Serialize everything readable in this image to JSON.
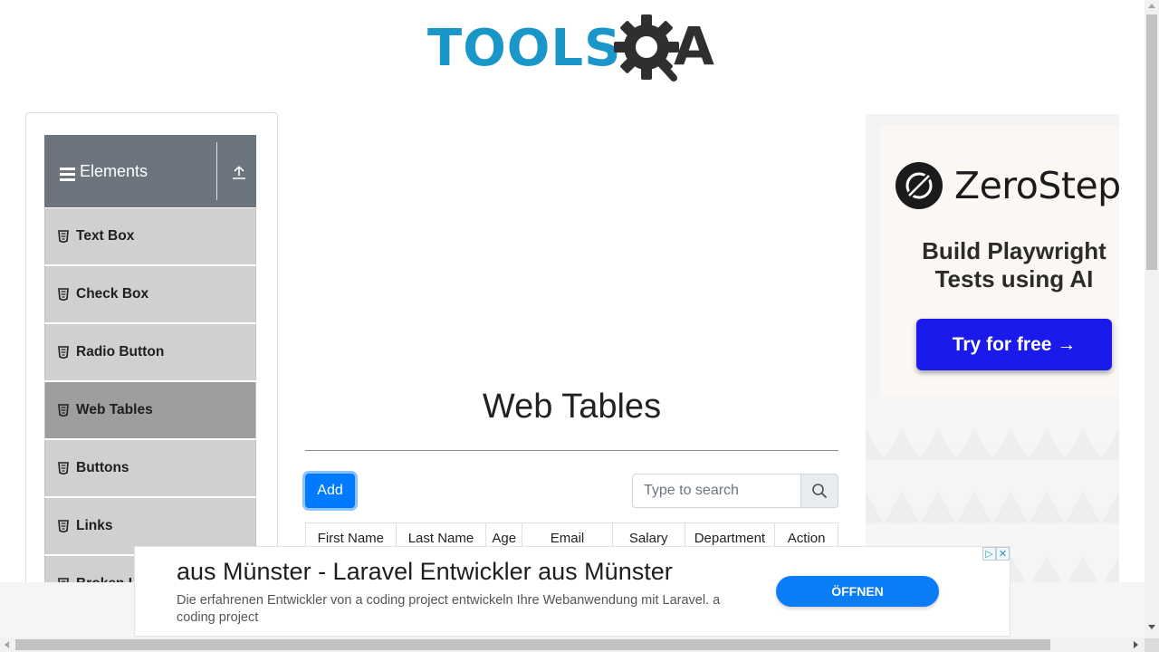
{
  "header": {
    "logo_text": "TOOLS",
    "logo_suffix": "A"
  },
  "sidebar": {
    "group_title": "Elements",
    "items": [
      {
        "label": "Text Box",
        "active": false
      },
      {
        "label": "Check Box",
        "active": false
      },
      {
        "label": "Radio Button",
        "active": false
      },
      {
        "label": "Web Tables",
        "active": true
      },
      {
        "label": "Buttons",
        "active": false
      },
      {
        "label": "Links",
        "active": false
      },
      {
        "label": "Broken Links - Images",
        "active": false
      }
    ]
  },
  "main": {
    "title": "Web Tables",
    "add_label": "Add",
    "search_placeholder": "Type to search",
    "columns": [
      "First Name",
      "Last Name",
      "Age",
      "Email",
      "Salary",
      "Department",
      "Action"
    ]
  },
  "side_ad": {
    "brand": "ZeroStep",
    "tagline": "Build Playwright Tests using AI",
    "cta": "Try for free →"
  },
  "bottom_ad": {
    "headline": "aus Münster - Laravel Entwickler aus Münster",
    "description": "Die erfahrenen Entwickler von a coding project entwickeln Ihre Webanwendung mit Laravel. a coding project",
    "button": "ÖFFNEN"
  },
  "colors": {
    "logo_blue": "#1a96c9",
    "logo_dark": "#2f2f2f",
    "group_header": "#6c757d",
    "menu_item": "#d0d0d0",
    "menu_item_active": "#9e9e9e",
    "primary": "#007bff",
    "ad_cta": "#1a1aec",
    "open_button": "#0a7cf5"
  }
}
